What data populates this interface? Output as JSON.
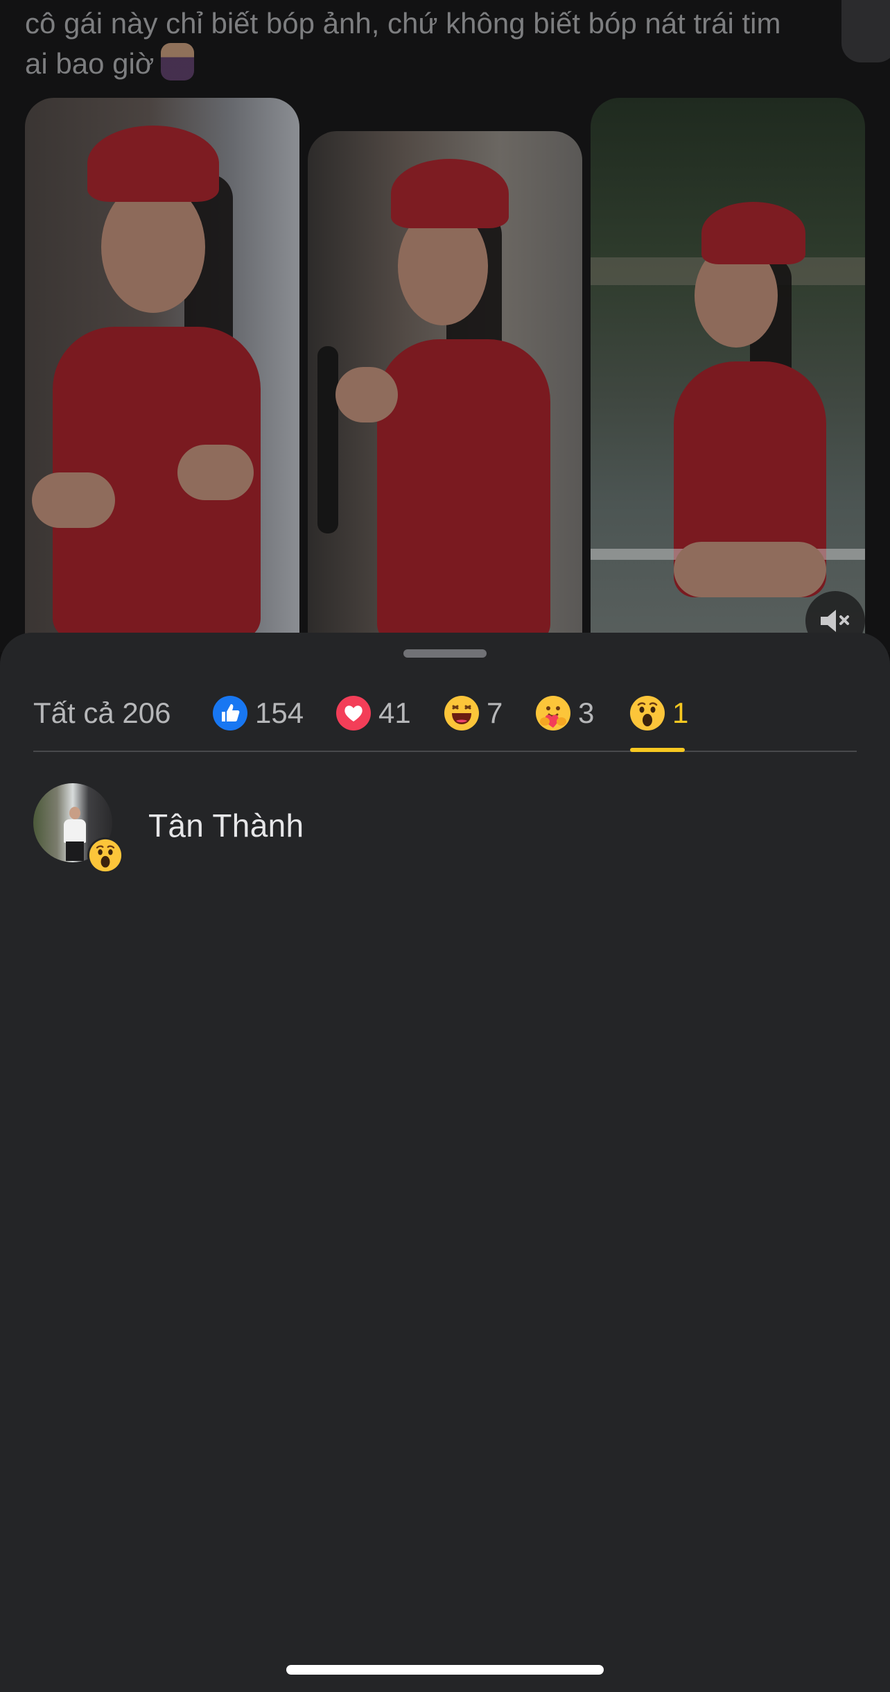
{
  "post": {
    "caption_line1": "cô gái này chỉ biết bóp ảnh, chứ không biết bóp nát trái tim",
    "caption_line2": "ai bao giờ",
    "caption_emoji": "woman-gesturing-emoji",
    "photos": [
      {
        "name": "photo-1"
      },
      {
        "name": "photo-2"
      },
      {
        "name": "photo-3"
      }
    ],
    "mute_icon": "speaker-muted-icon"
  },
  "reactions_sheet": {
    "tabs": [
      {
        "id": "all",
        "label": "Tất cả 206",
        "icon": null,
        "active": false
      },
      {
        "id": "like",
        "label": "154",
        "icon": "like-icon",
        "active": false
      },
      {
        "id": "love",
        "label": "41",
        "icon": "love-icon",
        "active": false
      },
      {
        "id": "haha",
        "label": "7",
        "icon": "haha-icon",
        "active": false
      },
      {
        "id": "care",
        "label": "3",
        "icon": "care-icon",
        "active": false
      },
      {
        "id": "wow",
        "label": "1",
        "icon": "wow-icon",
        "active": true
      }
    ],
    "colors": {
      "active_tab": "#f7c821",
      "like": "#1877f2",
      "love": "#f33e58",
      "emoji_yellow": "#fcc53a",
      "sheet_bg": "#242527"
    },
    "users": [
      {
        "name": "Tân Thành",
        "reaction": "wow-icon"
      }
    ]
  }
}
